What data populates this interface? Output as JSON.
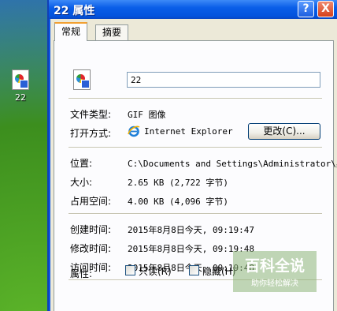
{
  "desktop": {
    "icon_label": "22",
    "icon_name": "gif-file-icon"
  },
  "window": {
    "title": "22 属性",
    "help_label": "?",
    "close_label": "X"
  },
  "tabs": [
    {
      "label": "常规",
      "selected": true
    },
    {
      "label": "摘要",
      "selected": false
    }
  ],
  "general": {
    "file_name": "22",
    "file_type_label": "文件类型:",
    "file_type_value": "GIF 图像",
    "open_with_label": "打开方式:",
    "open_with_value": "Internet Explorer",
    "open_with_icon": "ie-icon",
    "change_button": "更改(C)...",
    "location_label": "位置:",
    "location_value": "C:\\Documents and Settings\\Administrator\\桌",
    "size_label": "大小:",
    "size_value": "2.65 KB (2,722 字节)",
    "size_on_disk_label": "占用空间:",
    "size_on_disk_value": "4.00 KB (4,096 字节)",
    "created_label": "创建时间:",
    "created_value": "2015年8月8日今天, 09:19:47",
    "modified_label": "修改时间:",
    "modified_value": "2015年8月8日今天, 09:19:48",
    "accessed_label": "访问时间:",
    "accessed_value": "2015年8月8日今天, 09:19:48",
    "attributes_label": "属性:",
    "readonly_label": "只读(R)",
    "readonly_checked": false,
    "hidden_label": "隐藏(H)",
    "hidden_checked": false
  },
  "watermark": {
    "title": "百科全说",
    "subtitle": "助你轻松解决"
  },
  "colors": {
    "titlebar": "#0a5ee8",
    "client": "#ece9d8",
    "tab_highlight": "#f2a031"
  }
}
